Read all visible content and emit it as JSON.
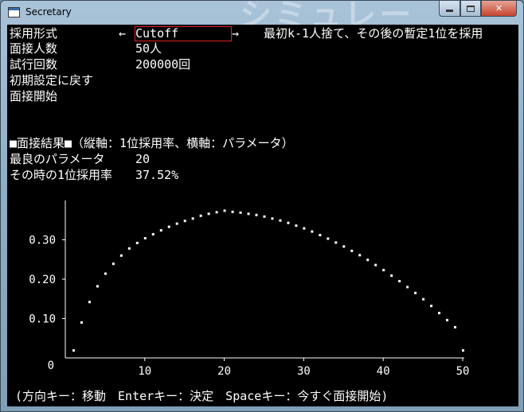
{
  "window": {
    "title": "Secretary",
    "background_text": "シミュレー"
  },
  "menu": {
    "rows": [
      {
        "label": "採用形式",
        "value": "Cutoff",
        "left_arrow": "←",
        "right_arrow": "→",
        "description": "最初k-1人捨て、その後の暫定1位を採用"
      },
      {
        "label": "面接人数",
        "value": "50人"
      },
      {
        "label": "試行回数",
        "value": "200000回"
      },
      {
        "label": "初期設定に戻す"
      },
      {
        "label": "面接開始"
      }
    ]
  },
  "results": {
    "heading": "■面接結果■（縦軸：1位採用率、横軸：パラメータ）",
    "best_label": "最良のパラメータ",
    "best_value": "20",
    "rate_label": "その時の1位採用率",
    "rate_value": "37.52%"
  },
  "chart_data": {
    "type": "scatter",
    "x": [
      1,
      2,
      3,
      4,
      5,
      6,
      7,
      8,
      9,
      10,
      11,
      12,
      13,
      14,
      15,
      16,
      17,
      18,
      19,
      20,
      21,
      22,
      23,
      24,
      25,
      26,
      27,
      28,
      29,
      30,
      31,
      32,
      33,
      34,
      35,
      36,
      37,
      38,
      39,
      40,
      41,
      42,
      43,
      44,
      45,
      46,
      47,
      48,
      49,
      50
    ],
    "y": [
      0.02,
      0.091,
      0.143,
      0.183,
      0.215,
      0.24,
      0.261,
      0.279,
      0.293,
      0.305,
      0.315,
      0.325,
      0.334,
      0.342,
      0.349,
      0.355,
      0.362,
      0.367,
      0.371,
      0.375,
      0.372,
      0.37,
      0.367,
      0.364,
      0.36,
      0.355,
      0.35,
      0.344,
      0.337,
      0.33,
      0.322,
      0.313,
      0.304,
      0.294,
      0.284,
      0.273,
      0.262,
      0.25,
      0.237,
      0.224,
      0.21,
      0.196,
      0.181,
      0.166,
      0.15,
      0.133,
      0.115,
      0.097,
      0.079,
      0.02
    ],
    "yticks": [
      "0.10",
      "0.20",
      "0.30"
    ],
    "ytick_values": [
      0.1,
      0.2,
      0.3
    ],
    "origin_label": "0",
    "xticks": [
      "10",
      "20",
      "30",
      "40",
      "50"
    ],
    "xtick_values": [
      10,
      20,
      30,
      40,
      50
    ],
    "xlim": [
      0,
      50
    ],
    "ylim": [
      0,
      0.4
    ],
    "point_color": "#ffffff",
    "grid": false
  },
  "footer": {
    "hint": "(方向キー：移動　Enterキー：決定　Spaceキー：今すぐ面接開始)"
  }
}
